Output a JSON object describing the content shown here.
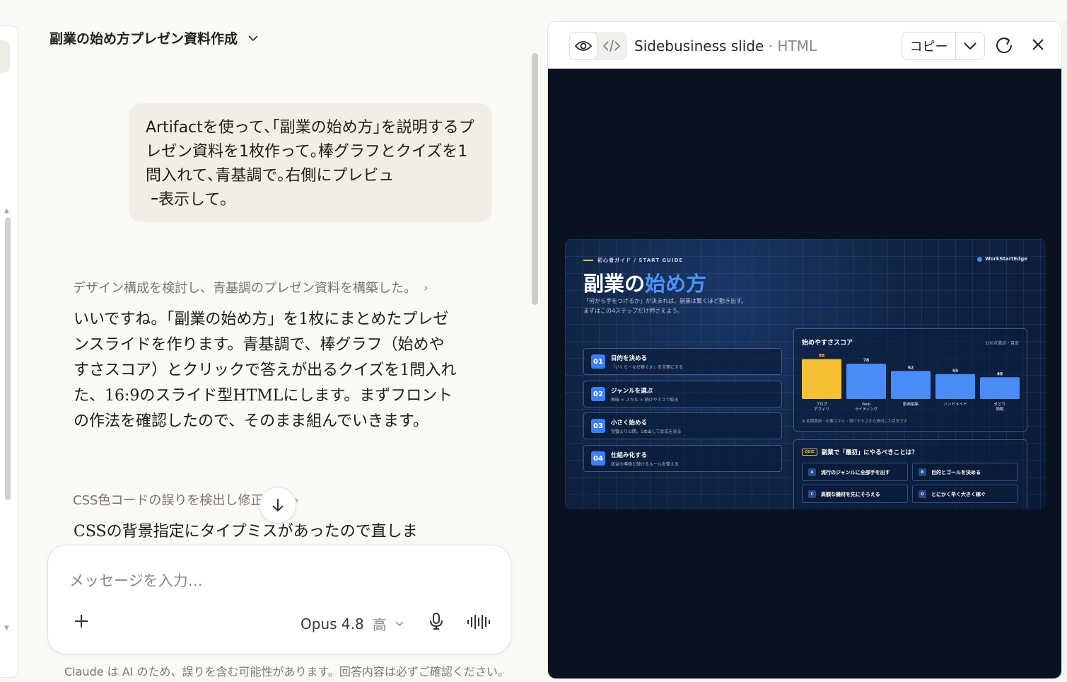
{
  "chat": {
    "title": "副業の始め方プレゼン資料作成",
    "user_message": "Artifactを使って､｢副業の始め方｣を説明するプレゼン資料を1枚作って｡棒グラフとクイズを1問入れて､青基調で｡右側にプレビュ\n ｰ表示して｡",
    "thinking_1": "デザイン構成を検討し、青基調のプレゼン資料を構築した。",
    "reply_1": "いいですね。「副業の始め方」を1枚にまとめたプレゼンスライドを作ります。青基調で、棒グラフ（始めやすさスコア）とクリックで答えが出るクイズを1問入れた、16:9のスライド型HTMLにします。まずフロントの作法を確認したので、そのまま組んでいきます。",
    "thinking_2": "CSS色コードの誤りを検出し修正",
    "reply_2": "CSSの背景指定にタイプミスがあったので直しま"
  },
  "composer": {
    "placeholder": "メッセージを入力…",
    "model": "Opus 4.8",
    "level": "高"
  },
  "disclaimer": "Claude は AI のため、誤りを含む可能性があります。回答内容は必ずご確認ください。",
  "artifact": {
    "title": "Sidebusiness slide",
    "type": "HTML",
    "separator": "·",
    "copy_label": "コピー"
  },
  "slide": {
    "tag": "初心者ガイド / START GUIDE",
    "brand": "WorkStartEdge",
    "title_a": "副業の",
    "title_b": "始め方",
    "sub_1": "「何から手をつけるか」が決まれば、副業は驚くほど動き出す。",
    "sub_2": "まずはこの4ステップだけ押さえよう。",
    "steps": [
      {
        "num": "01",
        "title": "目的を決める",
        "desc": "「いくら・なぜ稼ぐか」を言葉にする"
      },
      {
        "num": "02",
        "title": "ジャンルを選ぶ",
        "desc": "興味 × スキル × 続けやすさで絞る"
      },
      {
        "num": "03",
        "title": "小さく始める",
        "desc": "完璧より公開。1本出して反応を見る"
      },
      {
        "num": "04",
        "title": "仕組み化する",
        "desc": "収益の導線と続けるルールを整える"
      }
    ],
    "chart_title": "始めやすさスコア",
    "chart_note": "100点満点・目安",
    "chart_foot": "※ 初期費用・必要スキル・続けやすさから算出した目安です",
    "quiz_tag": "QUIZ",
    "quiz_question": "副業で「最初」にやるべきことは？",
    "options": [
      {
        "letter": "A",
        "text": "流行のジャンルに全部手を出す"
      },
      {
        "letter": "B",
        "text": "目的とゴールを決める"
      },
      {
        "letter": "C",
        "text": "高額な機材を先にそろえる"
      },
      {
        "letter": "D",
        "text": "とにかく早く大きく稼ぐ"
      }
    ]
  },
  "chart_data": {
    "type": "bar",
    "title": "始めやすさスコア",
    "categories": [
      "ブログ\nアフィリ",
      "Web\nライティング",
      "動画編集",
      "ハンドメイド",
      "せどり\n物販"
    ],
    "values": [
      88,
      78,
      62,
      55,
      48
    ],
    "ylim": [
      0,
      100
    ],
    "colors": {
      "highlight": "#f7bf35",
      "default": "#4a8cf5"
    },
    "grid": false
  }
}
